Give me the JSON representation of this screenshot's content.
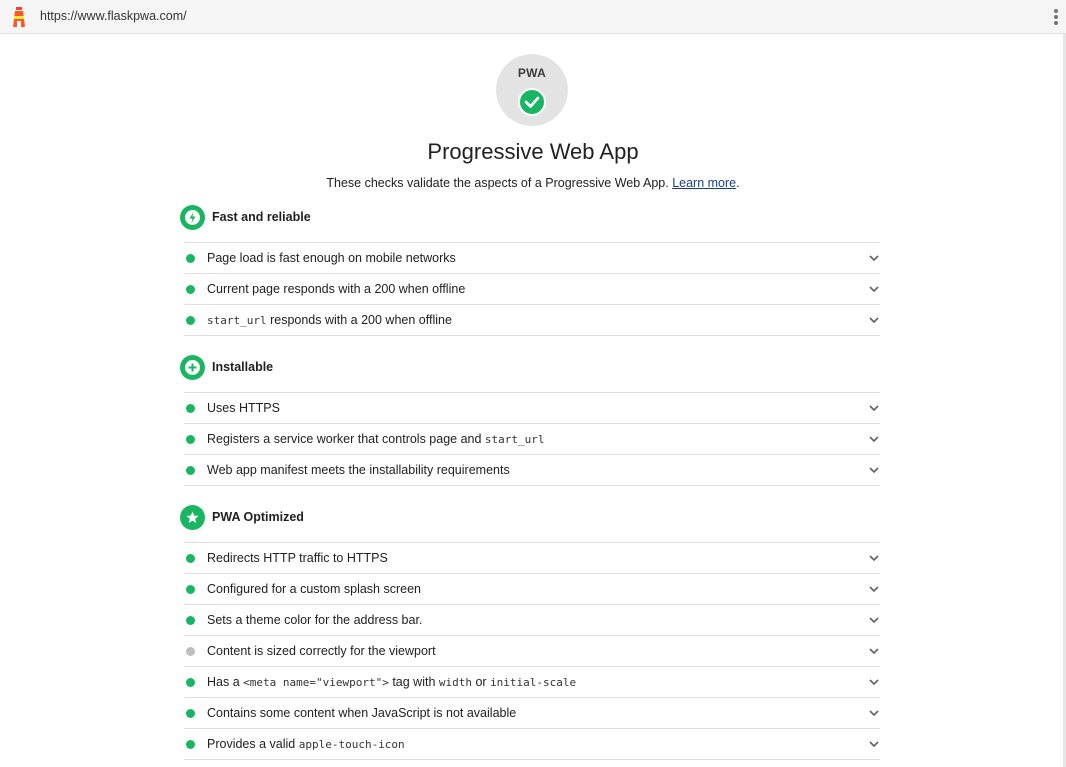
{
  "browser": {
    "url": "https://www.flaskpwa.com/"
  },
  "badge": {
    "text": "PWA"
  },
  "header": {
    "title": "Progressive Web App",
    "description": "These checks validate the aspects of a Progressive Web App.",
    "learn_more": "Learn more",
    "period": "."
  },
  "colors": {
    "pass": "#18b663",
    "not_applicable": "#bdbdbd"
  },
  "groups": [
    {
      "title": "Fast and reliable",
      "icon": "lightning-icon",
      "items": [
        {
          "parts": [
            {
              "t": "Page load is fast enough on mobile networks"
            }
          ],
          "status": "pass"
        },
        {
          "parts": [
            {
              "t": "Current page responds with a 200 when offline"
            }
          ],
          "status": "pass"
        },
        {
          "parts": [
            {
              "t": "start_url",
              "code": true
            },
            {
              "t": " responds with a 200 when offline"
            }
          ],
          "status": "pass"
        }
      ]
    },
    {
      "title": "Installable",
      "icon": "plus-icon",
      "items": [
        {
          "parts": [
            {
              "t": "Uses HTTPS"
            }
          ],
          "status": "pass"
        },
        {
          "parts": [
            {
              "t": "Registers a service worker that controls page and "
            },
            {
              "t": "start_url",
              "code": true
            }
          ],
          "status": "pass"
        },
        {
          "parts": [
            {
              "t": "Web app manifest meets the installability requirements"
            }
          ],
          "status": "pass"
        }
      ]
    },
    {
      "title": "PWA Optimized",
      "icon": "star-icon",
      "items": [
        {
          "parts": [
            {
              "t": "Redirects HTTP traffic to HTTPS"
            }
          ],
          "status": "pass"
        },
        {
          "parts": [
            {
              "t": "Configured for a custom splash screen"
            }
          ],
          "status": "pass"
        },
        {
          "parts": [
            {
              "t": "Sets a theme color for the address bar."
            }
          ],
          "status": "pass"
        },
        {
          "parts": [
            {
              "t": "Content is sized correctly for the viewport"
            }
          ],
          "status": "na"
        },
        {
          "parts": [
            {
              "t": "Has a "
            },
            {
              "t": "<meta name=\"viewport\">",
              "code": true
            },
            {
              "t": " tag with "
            },
            {
              "t": "width",
              "code": true
            },
            {
              "t": " or "
            },
            {
              "t": "initial-scale",
              "code": true
            }
          ],
          "status": "pass"
        },
        {
          "parts": [
            {
              "t": "Contains some content when JavaScript is not available"
            }
          ],
          "status": "pass"
        },
        {
          "parts": [
            {
              "t": "Provides a valid "
            },
            {
              "t": "apple-touch-icon",
              "code": true
            }
          ],
          "status": "pass"
        }
      ]
    }
  ]
}
